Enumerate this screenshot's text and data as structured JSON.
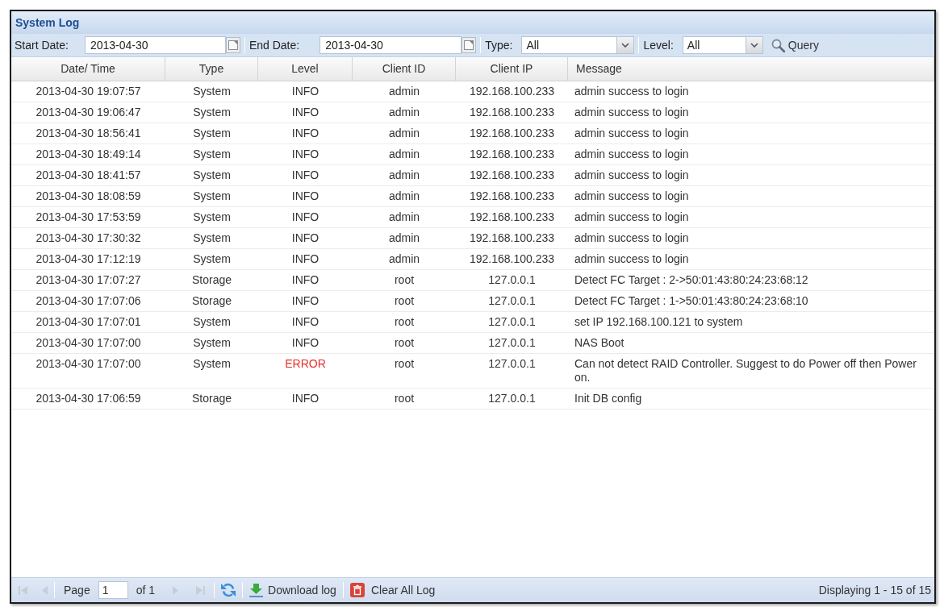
{
  "panel": {
    "title": "System Log"
  },
  "filters": {
    "start_date": {
      "label": "Start Date:",
      "value": "2013-04-30"
    },
    "end_date": {
      "label": "End Date:",
      "value": "2013-04-30"
    },
    "type": {
      "label": "Type:",
      "value": "All"
    },
    "level": {
      "label": "Level:",
      "value": "All"
    },
    "query_button": {
      "label": "Query"
    }
  },
  "table": {
    "columns": [
      "Date/ Time",
      "Type",
      "Level",
      "Client ID",
      "Client IP",
      "Message"
    ],
    "rows": [
      {
        "date_time": "2013-04-30 19:07:57",
        "type": "System",
        "level": "INFO",
        "kind": "info",
        "client_id": "admin",
        "client_ip": "192.168.100.233",
        "message": "admin success to login"
      },
      {
        "date_time": "2013-04-30 19:06:47",
        "type": "System",
        "level": "INFO",
        "kind": "info",
        "client_id": "admin",
        "client_ip": "192.168.100.233",
        "message": "admin success to login"
      },
      {
        "date_time": "2013-04-30 18:56:41",
        "type": "System",
        "level": "INFO",
        "kind": "info",
        "client_id": "admin",
        "client_ip": "192.168.100.233",
        "message": "admin success to login"
      },
      {
        "date_time": "2013-04-30 18:49:14",
        "type": "System",
        "level": "INFO",
        "kind": "info",
        "client_id": "admin",
        "client_ip": "192.168.100.233",
        "message": "admin success to login"
      },
      {
        "date_time": "2013-04-30 18:41:57",
        "type": "System",
        "level": "INFO",
        "kind": "info",
        "client_id": "admin",
        "client_ip": "192.168.100.233",
        "message": "admin success to login"
      },
      {
        "date_time": "2013-04-30 18:08:59",
        "type": "System",
        "level": "INFO",
        "kind": "info",
        "client_id": "admin",
        "client_ip": "192.168.100.233",
        "message": "admin success to login"
      },
      {
        "date_time": "2013-04-30 17:53:59",
        "type": "System",
        "level": "INFO",
        "kind": "info",
        "client_id": "admin",
        "client_ip": "192.168.100.233",
        "message": "admin success to login"
      },
      {
        "date_time": "2013-04-30 17:30:32",
        "type": "System",
        "level": "INFO",
        "kind": "info",
        "client_id": "admin",
        "client_ip": "192.168.100.233",
        "message": "admin success to login"
      },
      {
        "date_time": "2013-04-30 17:12:19",
        "type": "System",
        "level": "INFO",
        "kind": "info",
        "client_id": "admin",
        "client_ip": "192.168.100.233",
        "message": "admin success to login"
      },
      {
        "date_time": "2013-04-30 17:07:27",
        "type": "Storage",
        "level": "INFO",
        "kind": "info",
        "client_id": "root",
        "client_ip": "127.0.0.1",
        "message": "Detect FC Target : 2->50:01:43:80:24:23:68:12"
      },
      {
        "date_time": "2013-04-30 17:07:06",
        "type": "Storage",
        "level": "INFO",
        "kind": "info",
        "client_id": "root",
        "client_ip": "127.0.0.1",
        "message": "Detect FC Target : 1->50:01:43:80:24:23:68:10"
      },
      {
        "date_time": "2013-04-30 17:07:01",
        "type": "System",
        "level": "INFO",
        "kind": "info",
        "client_id": "root",
        "client_ip": "127.0.0.1",
        "message": "set IP 192.168.100.121 to system"
      },
      {
        "date_time": "2013-04-30 17:07:00",
        "type": "System",
        "level": "INFO",
        "kind": "info",
        "client_id": "root",
        "client_ip": "127.0.0.1",
        "message": "NAS Boot"
      },
      {
        "date_time": "2013-04-30 17:07:00",
        "type": "System",
        "level": "ERROR",
        "kind": "error",
        "client_id": "root",
        "client_ip": "127.0.0.1",
        "message": "Can not detect RAID Controller. Suggest to do Power off then Power on."
      },
      {
        "date_time": "2013-04-30 17:06:59",
        "type": "Storage",
        "level": "INFO",
        "kind": "info",
        "client_id": "root",
        "client_ip": "127.0.0.1",
        "message": "Init DB config"
      }
    ]
  },
  "pager": {
    "nav": [
      {
        "kind": "first",
        "disabled": true
      },
      {
        "kind": "previous",
        "disabled": true
      },
      {
        "kind": "next",
        "disabled": true
      },
      {
        "kind": "last",
        "disabled": true
      }
    ],
    "page_label": "Page",
    "page_value": "1",
    "page_total": "of 1"
  },
  "actions": [
    {
      "kind": "refresh"
    },
    {
      "kind": "download",
      "label": "Download log"
    },
    {
      "kind": "clear",
      "label": "Clear All Log"
    }
  ],
  "status": "Displaying 1 - 15 of 15"
}
